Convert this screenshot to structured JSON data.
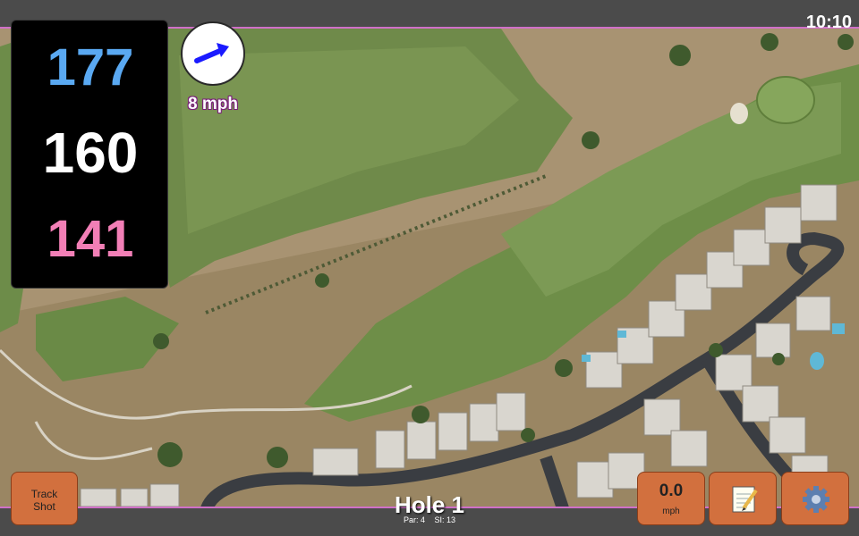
{
  "status": {
    "time": "10:10"
  },
  "distances": {
    "back": "177",
    "middle": "160",
    "front": "141"
  },
  "colors": {
    "back": "#5aa9f2",
    "middle": "#ffffff",
    "front": "#f27fb6",
    "button": "#d2703e",
    "wind_arrow": "#1a1aff"
  },
  "wind": {
    "speed": "8 mph",
    "arrow_icon": "arrow-right-icon"
  },
  "buttons": {
    "track_shot_line1": "Track",
    "track_shot_line2": "Shot",
    "speed_value": "0.0",
    "speed_unit": "mph",
    "notes_icon": "notepad-icon",
    "settings_icon": "gear-icon"
  },
  "hole": {
    "title": "Hole 1",
    "par": "Par: 4",
    "stroke_index": "SI: 13"
  }
}
